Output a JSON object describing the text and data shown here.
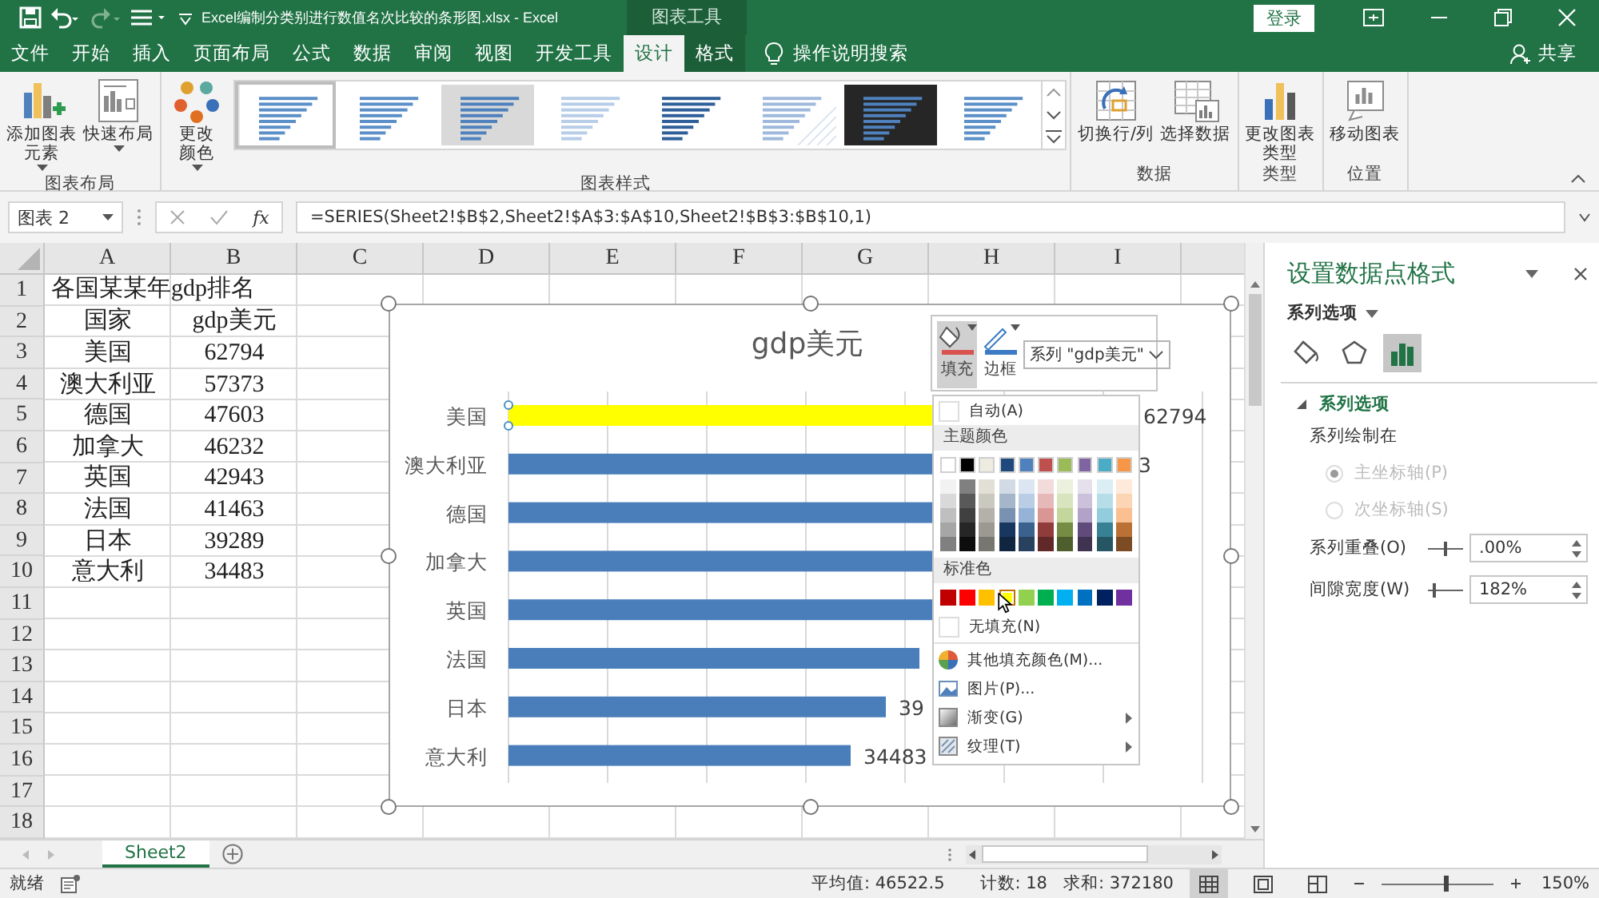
{
  "title_bar": {
    "title": "Excel编制分类别进行数值名次比较的条形图.xlsx - Excel",
    "context_tab": "图表工具",
    "sign_in": "登录"
  },
  "ribbon_tabs": [
    {
      "label": "文件",
      "selected": false,
      "contextual": false
    },
    {
      "label": "开始",
      "selected": false,
      "contextual": false
    },
    {
      "label": "插入",
      "selected": false,
      "contextual": false
    },
    {
      "label": "页面布局",
      "selected": false,
      "contextual": false
    },
    {
      "label": "公式",
      "selected": false,
      "contextual": false
    },
    {
      "label": "数据",
      "selected": false,
      "contextual": false
    },
    {
      "label": "审阅",
      "selected": false,
      "contextual": false
    },
    {
      "label": "视图",
      "selected": false,
      "contextual": false
    },
    {
      "label": "开发工具",
      "selected": false,
      "contextual": false
    },
    {
      "label": "设计",
      "selected": true,
      "contextual": true
    },
    {
      "label": "格式",
      "selected": false,
      "contextual": true
    }
  ],
  "tell_me": "操作说明搜索",
  "share": "共享",
  "ribbon_groups": [
    {
      "label": "图表布局",
      "buttons": [
        {
          "label": "添加图表元素",
          "dropdown": true,
          "kind": "add"
        },
        {
          "label": "快速布局",
          "dropdown": true,
          "kind": "layout"
        }
      ]
    },
    {
      "label": "图表样式",
      "buttons": [
        {
          "label": "更改颜色",
          "dropdown": true,
          "kind": "colors"
        }
      ],
      "gallery": [
        {
          "selected": true
        },
        {
          "selected": false
        },
        {
          "selected": false
        },
        {
          "selected": false
        },
        {
          "selected": false
        },
        {
          "selected": false
        },
        {
          "selected": false
        },
        {
          "selected": false
        }
      ]
    },
    {
      "label": "数据",
      "buttons": [
        {
          "label": "切换行/列",
          "dropdown": false,
          "kind": "switch"
        },
        {
          "label": "选择数据",
          "dropdown": false,
          "kind": "select"
        }
      ]
    },
    {
      "label": "类型",
      "buttons": [
        {
          "label": "更改图表类型",
          "dropdown": false,
          "kind": "type"
        }
      ]
    },
    {
      "label": "位置",
      "buttons": [
        {
          "label": "移动图表",
          "dropdown": false,
          "kind": "move"
        }
      ]
    }
  ],
  "formula_bar": {
    "name_box": "图表 2",
    "function_label": "fx",
    "formula": "=SERIES(Sheet2!$B$2,Sheet2!$A$3:$A$10,Sheet2!$B$3:$B$10,1)"
  },
  "sheet": {
    "columns": [
      "A",
      "B",
      "C",
      "D",
      "E",
      "F",
      "G",
      "H",
      "I"
    ],
    "rows": [
      {
        "number": "1",
        "cells": [
          "各国某某年gdp排名",
          ""
        ]
      },
      {
        "number": "2",
        "cells": [
          "国家",
          "gdp美元"
        ]
      },
      {
        "number": "3",
        "cells": [
          "美国",
          "62794"
        ]
      },
      {
        "number": "4",
        "cells": [
          "澳大利亚",
          "57373"
        ]
      },
      {
        "number": "5",
        "cells": [
          "德国",
          "47603"
        ]
      },
      {
        "number": "6",
        "cells": [
          "加拿大",
          "46232"
        ]
      },
      {
        "number": "7",
        "cells": [
          "英国",
          "42943"
        ]
      },
      {
        "number": "8",
        "cells": [
          "法国",
          "41463"
        ]
      },
      {
        "number": "9",
        "cells": [
          "日本",
          "39289"
        ]
      },
      {
        "number": "10",
        "cells": [
          "意大利",
          "34483"
        ]
      },
      {
        "number": "11",
        "cells": []
      },
      {
        "number": "12",
        "cells": []
      },
      {
        "number": "13",
        "cells": []
      },
      {
        "number": "14",
        "cells": []
      },
      {
        "number": "15",
        "cells": []
      },
      {
        "number": "16",
        "cells": []
      },
      {
        "number": "17",
        "cells": []
      },
      {
        "number": "18",
        "cells": []
      }
    ]
  },
  "chart": {
    "title": "gdp美元",
    "bars": [
      {
        "label": "美国",
        "selected": true,
        "color": "#ffff00",
        "value_label": "62794"
      },
      {
        "label": "澳大利亚",
        "selected": false,
        "color": "#4a7ebb",
        "value_label": "3"
      },
      {
        "label": "德国",
        "selected": false,
        "color": "#4a7ebb"
      },
      {
        "label": "加拿大",
        "selected": false,
        "color": "#4a7ebb"
      },
      {
        "label": "英国",
        "selected": false,
        "color": "#4a7ebb"
      },
      {
        "label": "法国",
        "selected": false,
        "color": "#4a7ebb"
      },
      {
        "label": "日本",
        "selected": false,
        "color": "#4a7ebb",
        "value_label": "39"
      },
      {
        "label": "意大利",
        "selected": false,
        "color": "#4a7ebb",
        "value_label": "34483"
      }
    ]
  },
  "format_popup": {
    "tools": [
      {
        "label": "填充",
        "kind": "fill",
        "color": "#d9534f",
        "selected": true
      },
      {
        "label": "边框",
        "kind": "border",
        "color": "#3c7cc4",
        "selected": false
      }
    ],
    "series_select": "系列 \"gdp美元\"",
    "menu": {
      "auto": "自动(A)",
      "theme_header": "主题颜色",
      "theme_colors": [
        {
          "color": "#ffffff"
        },
        {
          "color": "#000000"
        },
        {
          "color": "#eeece1"
        },
        {
          "color": "#1f497d"
        },
        {
          "color": "#4f81bd"
        },
        {
          "color": "#c0504d"
        },
        {
          "color": "#9bbb59"
        },
        {
          "color": "#8064a2"
        },
        {
          "color": "#4bacc6"
        },
        {
          "color": "#f79646"
        }
      ],
      "standard_header": "标准色",
      "standard_colors": [
        {
          "color": "#c00000",
          "selected": false
        },
        {
          "color": "#ff0000",
          "selected": false
        },
        {
          "color": "#ffc000",
          "selected": false
        },
        {
          "color": "#ffff00",
          "selected": true
        },
        {
          "color": "#92d050",
          "selected": false
        },
        {
          "color": "#00b050",
          "selected": false
        },
        {
          "color": "#00b0f0",
          "selected": false
        },
        {
          "color": "#0070c0",
          "selected": false
        },
        {
          "color": "#002060",
          "selected": false
        },
        {
          "color": "#7030a0",
          "selected": false
        }
      ],
      "items": [
        {
          "label": "无填充(N)",
          "kind": "empty",
          "submenu": false
        },
        {
          "label": "其他填充颜色(M)...",
          "kind": "palette",
          "submenu": false
        },
        {
          "label": "图片(P)...",
          "kind": "picture",
          "submenu": false
        },
        {
          "label": "渐变(G)",
          "kind": "gradient",
          "submenu": true
        },
        {
          "label": "纹理(T)",
          "kind": "texture",
          "submenu": true
        }
      ]
    }
  },
  "pane": {
    "title": "设置数据点格式",
    "options_dropdown": "系列选项",
    "tabs": [
      {
        "kind": "fill",
        "selected": false
      },
      {
        "kind": "shape",
        "selected": false
      },
      {
        "kind": "bars",
        "selected": true
      }
    ],
    "section": "系列选项",
    "section_expanded": true,
    "plot_on": "系列绘制在",
    "radios": [
      {
        "label": "主坐标轴(P)",
        "selected": true,
        "disabled": true
      },
      {
        "label": "次坐标轴(S)",
        "selected": false,
        "disabled": true
      }
    ],
    "settings": [
      {
        "label": "系列重叠(O)",
        "value": ".00%",
        "level": 0.5
      },
      {
        "label": "间隙宽度(W)",
        "value": "182%",
        "level": 0.2
      }
    ]
  },
  "sheet_tabs": [
    {
      "label": "Sheet2",
      "selected": true
    }
  ],
  "status_bar": {
    "ready": "就绪",
    "average": "平均值: 46522.5",
    "count": "计数: 18",
    "sum": "求和: 372180",
    "views": [
      {
        "kind": "normal",
        "selected": true
      },
      {
        "kind": "page-layout",
        "selected": false
      },
      {
        "kind": "page-break",
        "selected": false
      }
    ],
    "zoom": {
      "level": 0.57,
      "label": "150%"
    }
  }
}
